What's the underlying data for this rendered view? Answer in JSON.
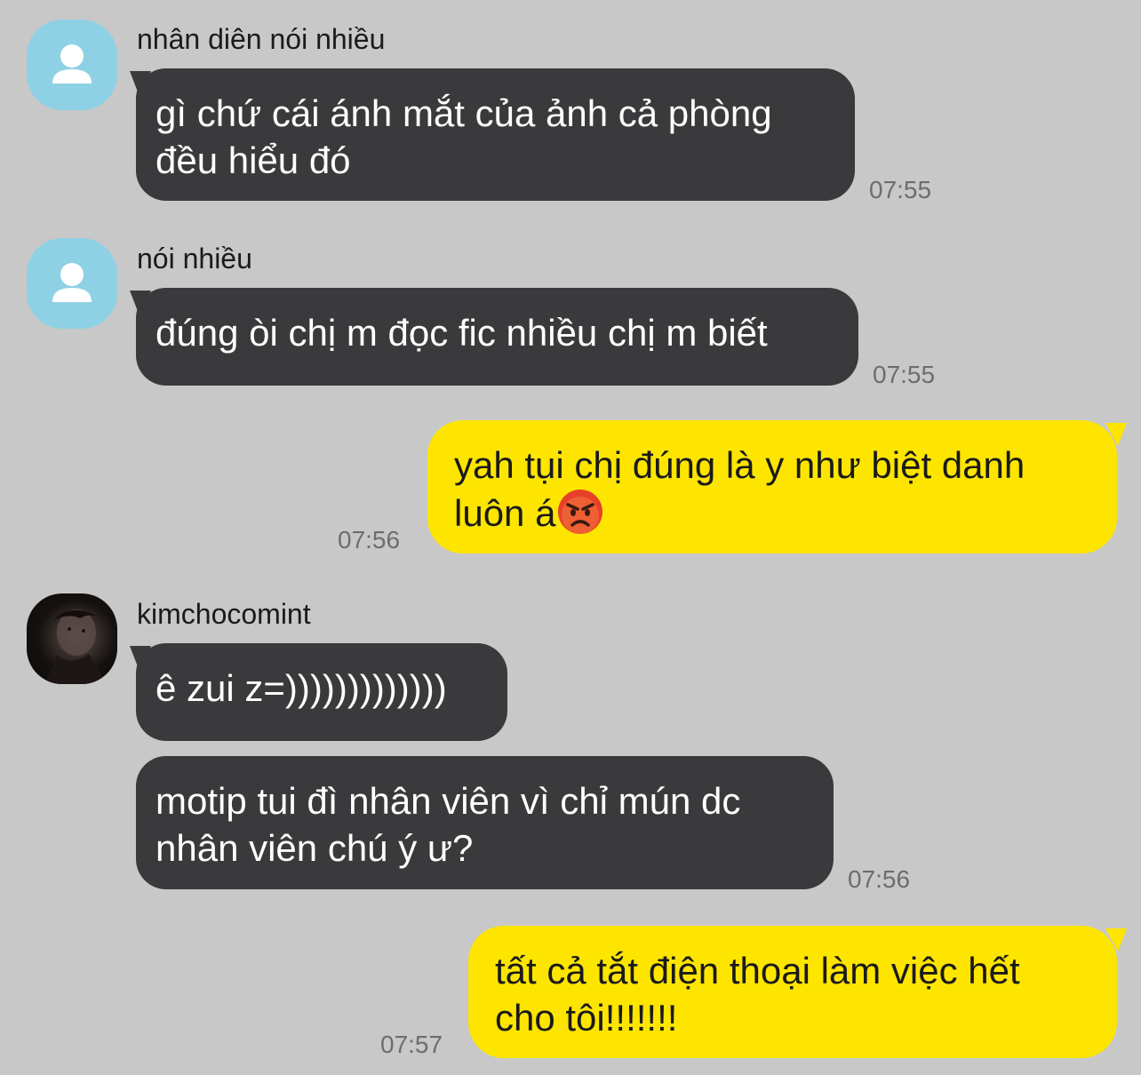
{
  "messages": [
    {
      "sender": "nhân diên nói nhiều",
      "avatar": "default-user-icon",
      "text": "gì chứ cái ánh mắt của ảnh cả phòng\nđều hiểu đó",
      "time": "07:55",
      "direction": "incoming"
    },
    {
      "sender": "nói nhiều",
      "avatar": "default-user-icon",
      "text": "đúng òi chị m đọc fic nhiều chị m biết",
      "time": "07:55",
      "direction": "incoming"
    },
    {
      "text": "yah tụi chị đúng là y như biệt danh\nluôn á",
      "emoji": "angry-face-emoji",
      "time": "07:56",
      "direction": "outgoing"
    },
    {
      "sender": "kimchocomint",
      "avatar": "profile-photo",
      "text": "ê zui z=)))))))))))))",
      "direction": "incoming"
    },
    {
      "text": "motip tui đì nhân viên vì chỉ mún dc\nnhân viên chú ý ư?",
      "time": "07:56",
      "direction": "incoming"
    },
    {
      "text": "tất cả tắt điện thoại làm việc hết\ncho tôi!!!!!!!",
      "time": "07:57",
      "direction": "outgoing"
    }
  ],
  "colors": {
    "background": "#c8c8c8",
    "incoming_bubble": "#3a3a3c",
    "outgoing_bubble": "#fde500",
    "default_avatar": "#8fd1e4"
  }
}
